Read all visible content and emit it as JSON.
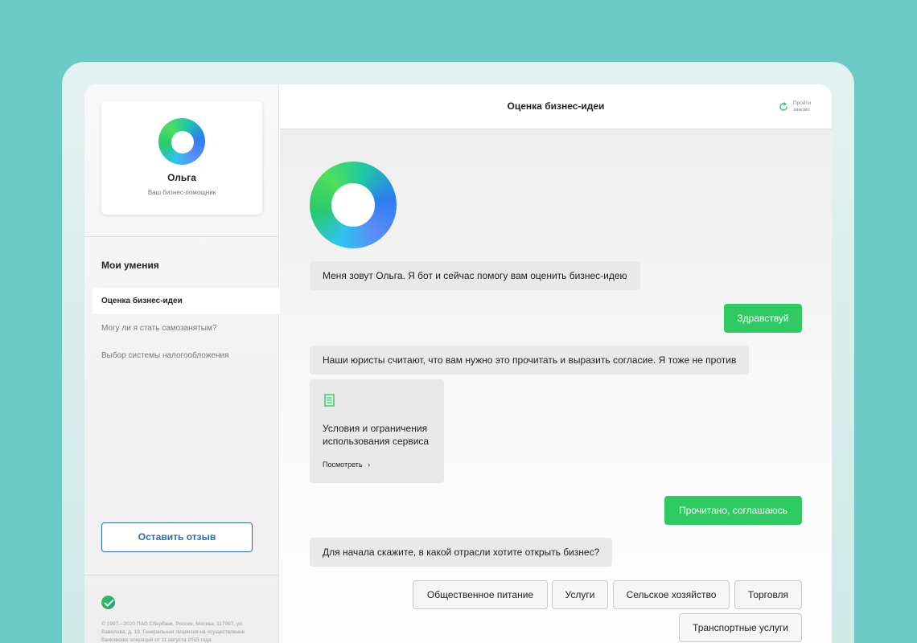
{
  "sidebar": {
    "profile": {
      "name": "Ольга",
      "subtitle": "Ваш бизнес-помощник"
    },
    "skills_title": "Мои умения",
    "skills": [
      {
        "label": "Оценка бизнес-идеи",
        "active": true
      },
      {
        "label": "Могу ли я стать самозанятым?",
        "active": false
      },
      {
        "label": "Выбор системы налогообложения",
        "active": false
      }
    ],
    "feedback_label": "Оставить отзыв",
    "copyright_lines": [
      "© 1997—2020 ПАО Сбербанк. Россия, Москва, 117997, ул.",
      "Вавилова, д. 19. Генеральная лицензия на осуществление",
      "банковских операций от 11 августа 2015 года"
    ]
  },
  "header": {
    "title": "Оценка бизнес-идеи",
    "restart_line1": "Пройти",
    "restart_line2": "заново"
  },
  "chat": {
    "messages": [
      {
        "from": "bot",
        "text": "Меня зовут Ольга. Я бот и сейчас помогу вам оценить бизнес-идею"
      },
      {
        "from": "user",
        "text": "Здравствуй"
      },
      {
        "from": "bot",
        "text": "Наши юристы считают, что вам нужно это прочитать и выразить согласие. Я тоже не против"
      },
      {
        "from": "user",
        "text": "Прочитано, соглашаюсь"
      },
      {
        "from": "bot",
        "text": "Для начала скажите, в какой отрасли хотите открыть бизнес?"
      }
    ],
    "document": {
      "title": "Условия и ограничения использования сервиса",
      "link": "Посмотреть",
      "link_arrow": "›"
    },
    "options": [
      "Общественное питание",
      "Услуги",
      "Сельское хозяйство",
      "Торговля",
      "Транспортные услуги"
    ]
  },
  "colors": {
    "accent_green": "#2fcb62",
    "link_blue": "#2f6ab5",
    "background": "#6acbc4"
  },
  "icons": {
    "restart": "refresh-icon",
    "document": "document-icon",
    "logo": "sber-logo-icon"
  }
}
